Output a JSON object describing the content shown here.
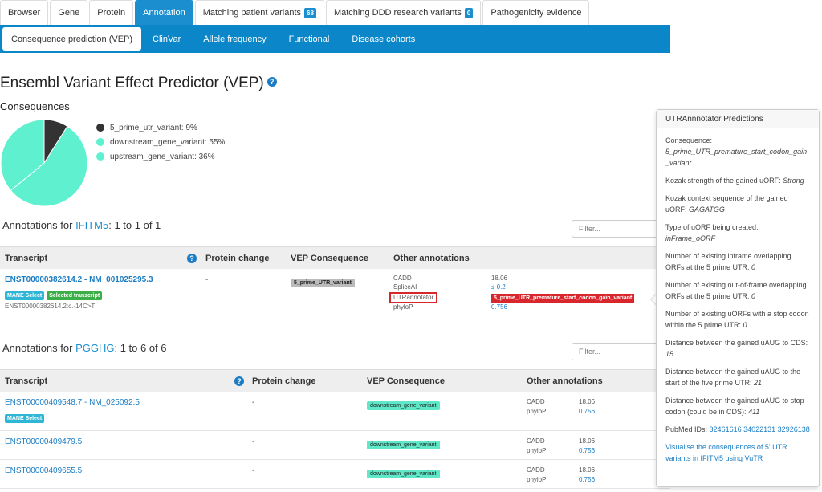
{
  "tabs_top": [
    {
      "label": "Browser"
    },
    {
      "label": "Gene"
    },
    {
      "label": "Protein"
    },
    {
      "label": "Annotation",
      "active": true
    },
    {
      "label": "Matching patient variants",
      "badge": "68"
    },
    {
      "label": "Matching DDD research variants",
      "badge": "0"
    },
    {
      "label": "Pathogenicity evidence"
    }
  ],
  "tabs_sub": [
    {
      "label": "Consequence prediction (VEP)",
      "active": true
    },
    {
      "label": "ClinVar"
    },
    {
      "label": "Allele frequency"
    },
    {
      "label": "Functional"
    },
    {
      "label": "Disease cohorts"
    }
  ],
  "page_title": "Ensembl Variant Effect Predictor (VEP)",
  "help_glyph": "?",
  "consequences": {
    "label": "Consequences",
    "items": [
      {
        "label": "5_prime_utr_variant: 9%",
        "percent": 9,
        "color": "#333333"
      },
      {
        "label": "downstream_gene_variant: 55%",
        "percent": 55,
        "color": "#5ef0cf"
      },
      {
        "label": "upstream_gene_variant: 36%",
        "percent": 36,
        "color": "#5ef0cf"
      }
    ]
  },
  "table_headers": {
    "transcript": "Transcript",
    "protein_change": "Protein change",
    "vep_consequence": "VEP Consequence",
    "other_annotations": "Other annotations"
  },
  "filter_placeholder": "Filter...",
  "ifitm5": {
    "heading_pre": "Annotations for ",
    "gene": "IFITM5",
    "heading_post": ": 1 to 1 of 1",
    "row": {
      "transcript": "ENST00000382614.2 - NM_001025295.3",
      "badges": [
        "MANE Select",
        "Selected transcript"
      ],
      "hgvs": "ENST00000382614.2:c.-14C>T",
      "protein_change": "-",
      "consequence": "5_prime_UTR_variant",
      "cadd_label": "CADD",
      "cadd_value": "18.06",
      "spliceai_label": "SpliceAI",
      "spliceai_value": "≤ 0.2",
      "utr_label": "UTRannotator",
      "utr_value": "5_prime_UTR_premature_start_codon_gain_variant",
      "phylop_label": "phyloP",
      "phylop_value": "0.756"
    }
  },
  "pgghg": {
    "heading_pre": "Annotations for ",
    "gene": "PGGHG",
    "heading_post": ": 1 to 6 of 6",
    "rows": [
      {
        "transcript": "ENST00000409548.7 - NM_025092.5",
        "badge": "MANE Select",
        "protein_change": "-",
        "consequence": "downstream_gene_variant",
        "cadd_label": "CADD",
        "cadd_value": "18.06",
        "phylop_label": "phyloP",
        "phylop_value": "0.756"
      },
      {
        "transcript": "ENST00000409479.5",
        "protein_change": "-",
        "consequence": "downstream_gene_variant",
        "cadd_label": "CADD",
        "cadd_value": "18.06",
        "phylop_label": "phyloP",
        "phylop_value": "0.756"
      },
      {
        "transcript": "ENST00000409655.5",
        "protein_change": "-",
        "consequence": "downstream_gene_variant",
        "cadd_label": "CADD",
        "cadd_value": "18.06",
        "phylop_label": "phyloP",
        "phylop_value": "0.756"
      }
    ]
  },
  "popover": {
    "title": "UTRAnnnotator Predictions",
    "items": [
      {
        "label": "Consequence:",
        "value": "5_prime_UTR_premature_start_codon_gain_variant"
      },
      {
        "label": "Kozak strength of the gained uORF:",
        "value": "Strong"
      },
      {
        "label": "Kozak context sequence of the gained uORF:",
        "value": "GAGATGG"
      },
      {
        "label": "Type of uORF being created:",
        "value": "inFrame_oORF"
      },
      {
        "label": "Number of existing inframe overlapping ORFs at the 5 prime UTR:",
        "value": "0"
      },
      {
        "label": "Number of existing out-of-frame overlapping ORFs at the 5 prime UTR:",
        "value": "0"
      },
      {
        "label": "Number of existing uORFs with a stop codon within the 5 prime UTR:",
        "value": "0"
      },
      {
        "label": "Distance between the gained uAUG to CDS:",
        "value": "15"
      },
      {
        "label": "Distance between the gained uAUG to the start of the five prime UTR:",
        "value": "21"
      },
      {
        "label": "Distance between the gained uAUG to stop codon (could be in CDS):",
        "value": "411"
      }
    ],
    "pubmed_label": "PubMed IDs:",
    "pubmed_ids": [
      "32461616",
      "34022131",
      "32926138"
    ],
    "visualise_link": "Visualise the consequences of 5' UTR variants in IFITM5 using VuTR"
  }
}
